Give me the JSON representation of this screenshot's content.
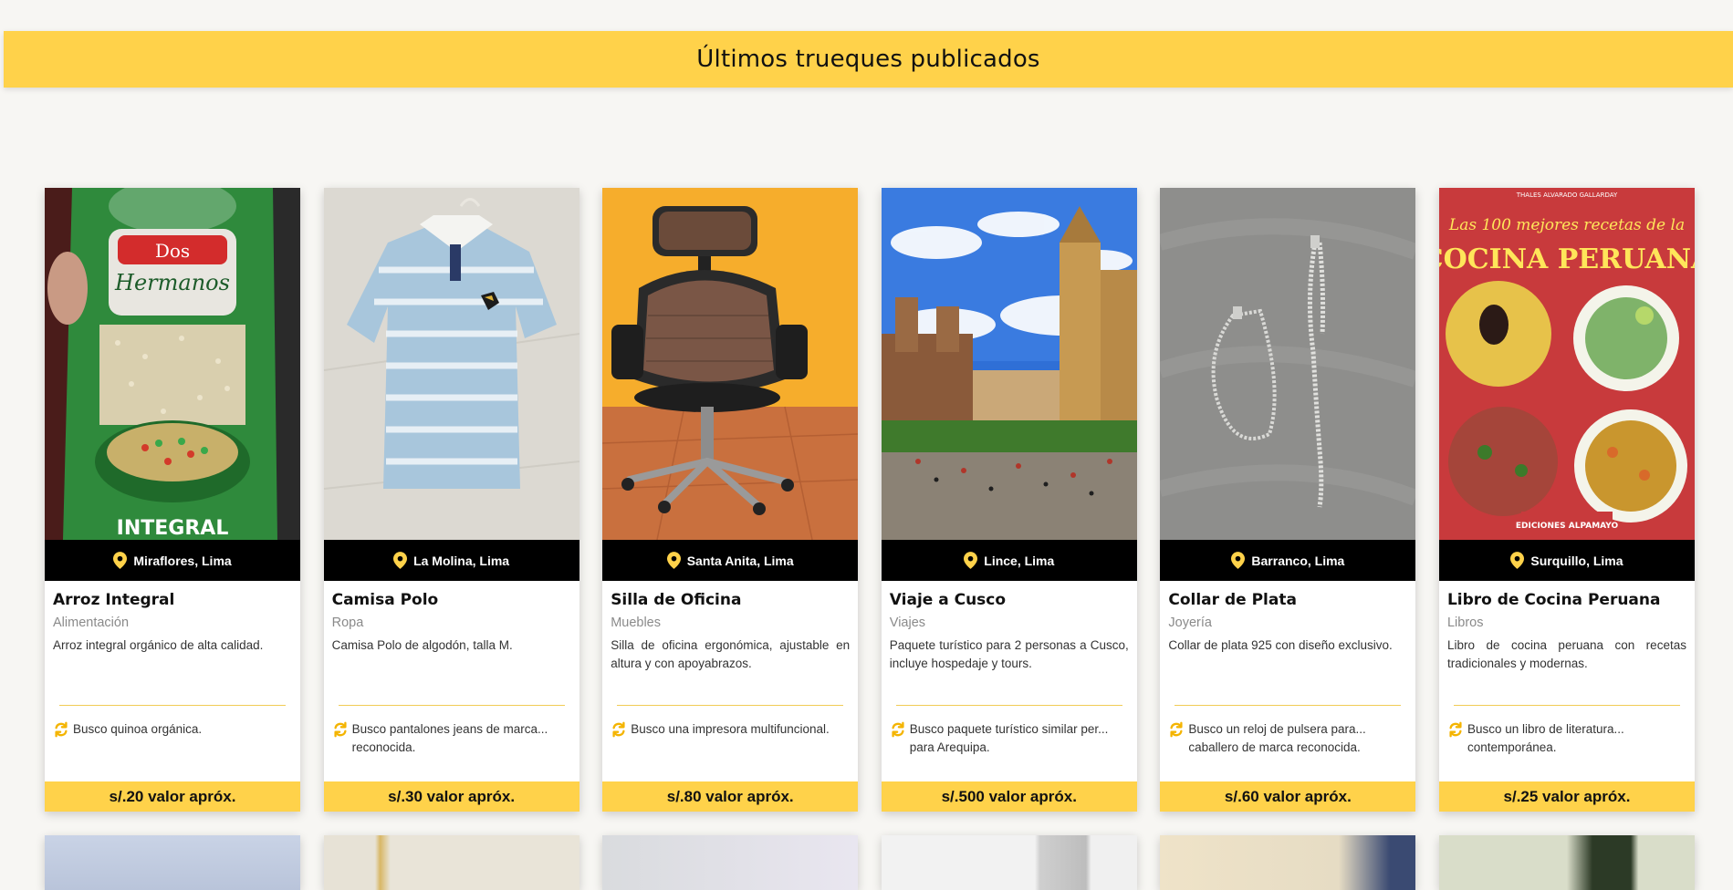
{
  "header": {
    "title": "Últimos trueques publicados"
  },
  "colors": {
    "accent": "#ffd24a",
    "location_bar": "#000000",
    "divider": "#f1cc55"
  },
  "cards": [
    {
      "title": "Arroz Integral",
      "category": "Alimentación",
      "location": "Miraflores, Lima",
      "description": "Arroz integral orgánico de alta calidad.",
      "seeking": "Busco quinoa orgánica.",
      "price": "s/.20 valor apróx.",
      "image": "rice-bag-photo"
    },
    {
      "title": "Camisa Polo",
      "category": "Ropa",
      "location": "La Molina, Lima",
      "description": "Camisa Polo de algodón, talla M.",
      "seeking": "Busco pantalones jeans de marca... reconocida.",
      "price": "s/.30 valor apróx.",
      "image": "striped-polo-shirt-photo"
    },
    {
      "title": "Silla de Oficina",
      "category": "Muebles",
      "location": "Santa Anita, Lima",
      "description": "Silla de oficina ergonómica, ajustable en altura y con apoyabrazos.",
      "seeking": "Busco una impresora multifuncional.",
      "price": "s/.80 valor apróx.",
      "image": "office-chair-photo"
    },
    {
      "title": "Viaje a Cusco",
      "category": "Viajes",
      "location": "Lince, Lima",
      "description": "Paquete turístico para 2 personas a Cusco, incluye hospedaje y tours.",
      "seeking": "Busco paquete turístico similar per... para Arequipa.",
      "price": "s/.500 valor apróx.",
      "image": "cusco-plaza-photo"
    },
    {
      "title": "Collar de Plata",
      "category": "Joyería",
      "location": "Barranco, Lima",
      "description": "Collar de plata 925 con diseño exclusivo.",
      "seeking": "Busco un reloj de pulsera para... caballero de marca reconocida.",
      "price": "s/.60 valor apróx.",
      "image": "silver-necklace-photo"
    },
    {
      "title": "Libro de Cocina Peruana",
      "category": "Libros",
      "location": "Surquillo, Lima",
      "description": "Libro de cocina peruana con recetas tradicionales y modernas.",
      "seeking": "Busco un libro de literatura... contemporánea.",
      "price": "s/.25 valor apróx.",
      "image": "cookbook-cover-photo",
      "image_text": {
        "author": "THALES ALVARADO GALLARDAY",
        "line1": "Las 100 mejores recetas de la",
        "line2": "COCINA PERUANA",
        "publisher": "EDICIONES ALPAMAYO"
      }
    }
  ]
}
